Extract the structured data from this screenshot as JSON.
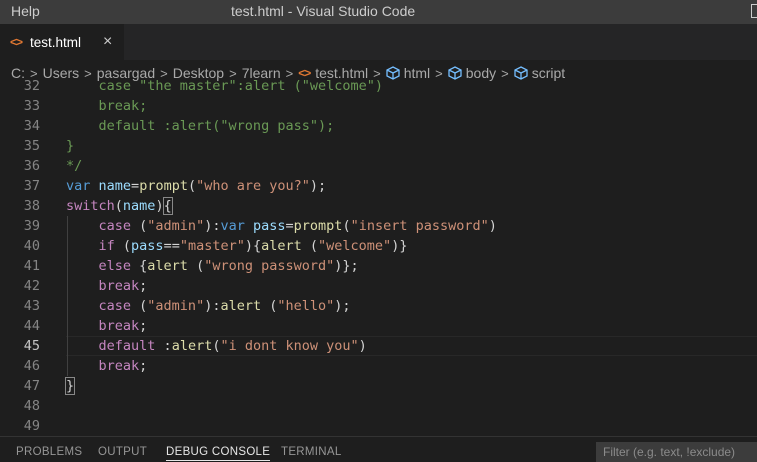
{
  "titlebar": {
    "menu_label": "Help",
    "window_title": "test.html - Visual Studio Code"
  },
  "tab": {
    "label": "test.html",
    "file_icon_glyph": "<>",
    "close_glyph": "×"
  },
  "breadcrumb": {
    "items": [
      "C:",
      "Users",
      "pasargad",
      "Desktop",
      "7learn",
      "test.html",
      "html",
      "body",
      "script"
    ],
    "separator": ">",
    "html_icon_glyph": "<>"
  },
  "colors": {
    "keyword": "#569cd6",
    "control": "#c586c0",
    "string": "#ce9178",
    "function": "#dcdcaa",
    "variable": "#9cdcfe",
    "comment": "#6a9955",
    "text": "#d4d4d4",
    "accent_icon": "#e37933",
    "symbol_icon": "#75beff"
  },
  "editor": {
    "active_line": 45,
    "lines": [
      {
        "n": "32",
        "tokens": [
          [
            "    case \"the master\":alert (\"welcome\")",
            "comment"
          ]
        ]
      },
      {
        "n": "33",
        "tokens": [
          [
            "    break;",
            "comment"
          ]
        ]
      },
      {
        "n": "34",
        "tokens": [
          [
            "    default :alert(\"wrong pass\");",
            "comment"
          ]
        ]
      },
      {
        "n": "35",
        "tokens": [
          [
            "}",
            "comment"
          ]
        ]
      },
      {
        "n": "36",
        "tokens": [
          [
            "*/",
            "comment"
          ]
        ]
      },
      {
        "n": "37",
        "tokens": [
          [
            "var",
            "keyword"
          ],
          [
            " ",
            "text"
          ],
          [
            "name",
            "variable"
          ],
          [
            "=",
            "text"
          ],
          [
            "prompt",
            "function"
          ],
          [
            "(",
            "text"
          ],
          [
            "\"who are you?\"",
            "string"
          ],
          [
            ");",
            "text"
          ]
        ]
      },
      {
        "n": "38",
        "tokens": [
          [
            "switch",
            "control"
          ],
          [
            "(",
            "text"
          ],
          [
            "name",
            "variable"
          ],
          [
            ")",
            "text"
          ],
          [
            "{",
            "text"
          ]
        ]
      },
      {
        "n": "39",
        "tokens": [
          [
            "    ",
            "text"
          ],
          [
            "case",
            "control"
          ],
          [
            " (",
            "text"
          ],
          [
            "\"admin\"",
            "string"
          ],
          [
            "):",
            "text"
          ],
          [
            "var",
            "keyword"
          ],
          [
            " ",
            "text"
          ],
          [
            "pass",
            "variable"
          ],
          [
            "=",
            "text"
          ],
          [
            "prompt",
            "function"
          ],
          [
            "(",
            "text"
          ],
          [
            "\"insert password\"",
            "string"
          ],
          [
            ")",
            "text"
          ]
        ]
      },
      {
        "n": "40",
        "tokens": [
          [
            "    ",
            "text"
          ],
          [
            "if",
            "control"
          ],
          [
            " (",
            "text"
          ],
          [
            "pass",
            "variable"
          ],
          [
            "==",
            "text"
          ],
          [
            "\"master\"",
            "string"
          ],
          [
            "){",
            "text"
          ],
          [
            "alert",
            "function"
          ],
          [
            " (",
            "text"
          ],
          [
            "\"welcome\"",
            "string"
          ],
          [
            ")}",
            "text"
          ]
        ]
      },
      {
        "n": "41",
        "tokens": [
          [
            "    ",
            "text"
          ],
          [
            "else",
            "control"
          ],
          [
            " {",
            "text"
          ],
          [
            "alert",
            "function"
          ],
          [
            " (",
            "text"
          ],
          [
            "\"wrong password\"",
            "string"
          ],
          [
            ")};",
            "text"
          ]
        ]
      },
      {
        "n": "42",
        "tokens": [
          [
            "    ",
            "text"
          ],
          [
            "break",
            "control"
          ],
          [
            ";",
            "text"
          ]
        ]
      },
      {
        "n": "43",
        "tokens": [
          [
            "    ",
            "text"
          ],
          [
            "case",
            "control"
          ],
          [
            " (",
            "text"
          ],
          [
            "\"admin\"",
            "string"
          ],
          [
            "):",
            "text"
          ],
          [
            "alert",
            "function"
          ],
          [
            " (",
            "text"
          ],
          [
            "\"hello\"",
            "string"
          ],
          [
            ");",
            "text"
          ]
        ]
      },
      {
        "n": "44",
        "tokens": [
          [
            "    ",
            "text"
          ],
          [
            "break",
            "control"
          ],
          [
            ";",
            "text"
          ]
        ]
      },
      {
        "n": "45",
        "tokens": [
          [
            "    ",
            "text"
          ],
          [
            "default",
            "control"
          ],
          [
            " :",
            "text"
          ],
          [
            "alert",
            "function"
          ],
          [
            "(",
            "text"
          ],
          [
            "\"i dont know you\"",
            "string"
          ],
          [
            ")",
            "text"
          ]
        ]
      },
      {
        "n": "46",
        "tokens": [
          [
            "    ",
            "text"
          ],
          [
            "break",
            "control"
          ],
          [
            ";",
            "text"
          ]
        ]
      },
      {
        "n": "47",
        "tokens": [
          [
            "}",
            "text"
          ]
        ]
      },
      {
        "n": "48",
        "tokens": []
      },
      {
        "n": "49",
        "tokens": []
      }
    ]
  },
  "panel": {
    "tabs": [
      {
        "label": "PROBLEMS",
        "active": false
      },
      {
        "label": "OUTPUT",
        "active": false
      },
      {
        "label": "DEBUG CONSOLE",
        "active": true
      },
      {
        "label": "TERMINAL",
        "active": false
      }
    ],
    "filter_placeholder": "Filter (e.g. text, !exclude)"
  }
}
